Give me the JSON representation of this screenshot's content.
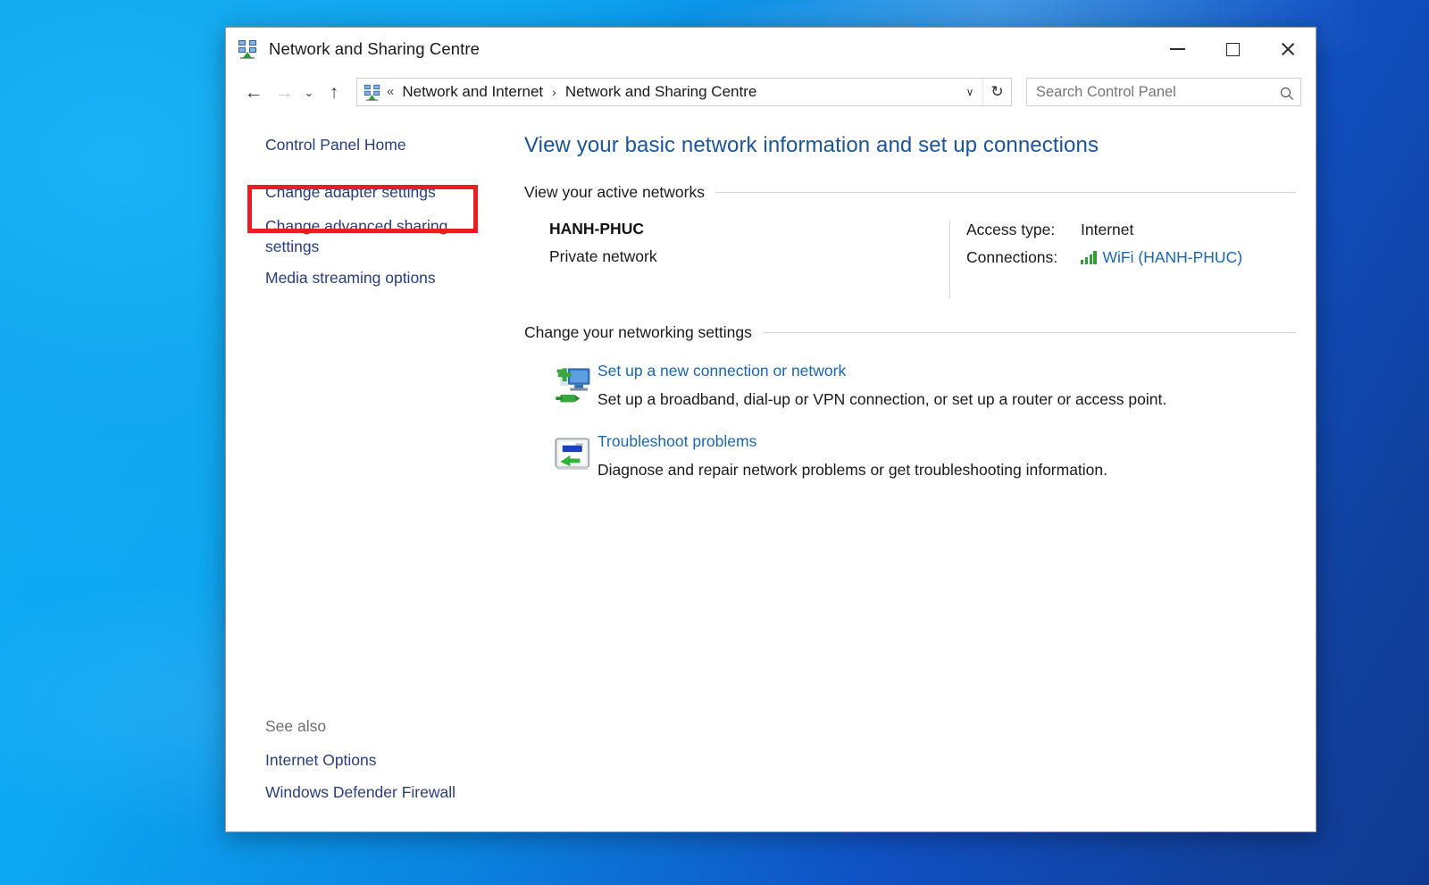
{
  "window": {
    "title": "Network and Sharing Centre",
    "app_icon": "network-sharing-icon",
    "controls": {
      "minimize_label": "Minimize",
      "maximize_label": "Maximize",
      "close_label": "Close"
    }
  },
  "navbar": {
    "back_label": "Back",
    "forward_label": "Forward",
    "recent_label": "Recent locations",
    "up_label": "Up",
    "breadcrumb": {
      "icon": "network-sharing-icon",
      "prefix": "«",
      "items": [
        "Network and Internet",
        "Network and Sharing Centre"
      ],
      "separator": "›",
      "dropdown_glyph": "∨",
      "refresh_glyph": "↻"
    },
    "search": {
      "placeholder": "Search Control Panel",
      "value": "",
      "icon": "search-icon"
    }
  },
  "sidebar": {
    "items": [
      {
        "label": "Control Panel Home",
        "name": "control-panel-home"
      },
      {
        "label": "Change adapter settings",
        "name": "change-adapter-settings",
        "highlighted": true
      },
      {
        "label": "Change advanced sharing settings",
        "name": "change-advanced-sharing-settings"
      },
      {
        "label": "Media streaming options",
        "name": "media-streaming-options"
      }
    ],
    "see_also": {
      "heading": "See also",
      "items": [
        {
          "label": "Internet Options",
          "name": "internet-options"
        },
        {
          "label": "Windows Defender Firewall",
          "name": "windows-defender-firewall"
        }
      ]
    },
    "highlight_color": "#ec1c24"
  },
  "main": {
    "page_title": "View your basic network information and set up connections",
    "active_networks": {
      "heading": "View your active networks",
      "network": {
        "name": "HANH-PHUC",
        "type": "Private network",
        "access_type_key": "Access type:",
        "access_type_value": "Internet",
        "connections_key": "Connections:",
        "connections_value": "WiFi (HANH-PHUC)",
        "connections_icon": "wifi-signal-icon"
      }
    },
    "networking_settings": {
      "heading": "Change your networking settings",
      "tasks": [
        {
          "icon": "new-connection-icon",
          "link": "Set up a new connection or network",
          "description": "Set up a broadband, dial-up or VPN connection, or set up a router or access point."
        },
        {
          "icon": "troubleshoot-icon",
          "link": "Troubleshoot problems",
          "description": "Diagnose and repair network problems or get troubleshooting information."
        }
      ]
    }
  },
  "colors": {
    "link": "#1767b5",
    "sidebar_link": "#2a3c80",
    "title_heading": "#18559c",
    "highlight": "#ec1c24",
    "desktop_left": "#0fb0f7",
    "desktop_right": "#11419f"
  }
}
